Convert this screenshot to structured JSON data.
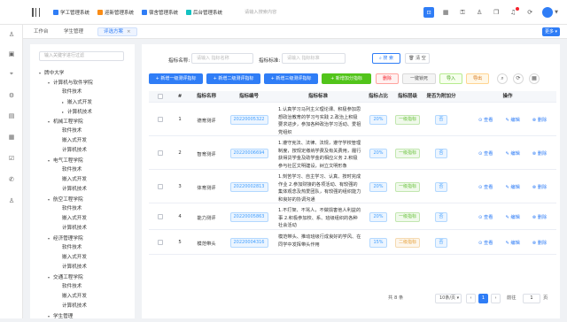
{
  "header": {
    "systems": [
      {
        "label": "学工管理系统",
        "icon": "graduation-icon",
        "color": "#2f7df6"
      },
      {
        "label": "迎新管理系统",
        "icon": "welcome-icon",
        "color": "#fa8c16"
      },
      {
        "label": "宿舍管理系统",
        "icon": "dorm-icon",
        "color": "#2f7df6"
      },
      {
        "label": "后台管理系统",
        "icon": "admin-icon",
        "color": "#13c2c2"
      }
    ],
    "search_placeholder": "请输入搜索内容",
    "icons": [
      "scan-icon",
      "calendar-icon",
      "lock-icon",
      "shirt-icon",
      "copy-icon",
      "bell-icon",
      "refresh-icon",
      "user-avatar"
    ]
  },
  "left_icons": [
    "person-icon",
    "user-card-icon",
    "pin-icon",
    "settings-icon",
    "book-icon",
    "grid-icon",
    "chart-icon",
    "phone-icon",
    "person2-icon"
  ],
  "tabs": [
    {
      "label": "工作台"
    },
    {
      "label": "学生管理"
    },
    {
      "label": "评选方案",
      "active": true
    }
  ],
  "more_label": "更多",
  "tree": {
    "search_placeholder": "输入关键字进行过滤",
    "nodes": [
      {
        "label": "牌中大学",
        "level": 0,
        "expanded": true
      },
      {
        "label": "计算机与软件学院",
        "level": 1,
        "expanded": true
      },
      {
        "label": "软件技术",
        "level": 2
      },
      {
        "label": "嵌入式开发",
        "level": 2,
        "collapsed": true
      },
      {
        "label": "计算机技术",
        "level": 2,
        "collapsed": true
      },
      {
        "label": "机械工程学院",
        "level": 1,
        "expanded": true
      },
      {
        "label": "软件技术",
        "level": 2
      },
      {
        "label": "嵌入式开发",
        "level": 2
      },
      {
        "label": "计算机技术",
        "level": 2
      },
      {
        "label": "电气工程学院",
        "level": 1,
        "expanded": true
      },
      {
        "label": "软件技术",
        "level": 2
      },
      {
        "label": "嵌入式开发",
        "level": 2
      },
      {
        "label": "计算机技术",
        "level": 2
      },
      {
        "label": "航空工程学院",
        "level": 1,
        "expanded": true
      },
      {
        "label": "软件技术",
        "level": 2
      },
      {
        "label": "嵌入式开发",
        "level": 2
      },
      {
        "label": "计算机技术",
        "level": 2
      },
      {
        "label": "经济管理学院",
        "level": 1,
        "expanded": true
      },
      {
        "label": "软件技术",
        "level": 2
      },
      {
        "label": "嵌入式开发",
        "level": 2
      },
      {
        "label": "计算机技术",
        "level": 2
      },
      {
        "label": "交通工程学院",
        "level": 1,
        "expanded": true
      },
      {
        "label": "软件技术",
        "level": 2
      },
      {
        "label": "嵌入式开发",
        "level": 2
      },
      {
        "label": "计算机技术",
        "level": 2
      },
      {
        "label": "学生管理",
        "level": 1,
        "expanded": true
      }
    ]
  },
  "filters": {
    "name_label": "指标名称:",
    "name_placeholder": "请输入 指标名称",
    "std_label": "指标标准:",
    "std_placeholder": "请输入 指标标准",
    "search_label": "搜 索",
    "clear_label": "清 空"
  },
  "toolbar": {
    "buttons": [
      {
        "label": "+ 新增一级测评指标",
        "style": "blue"
      },
      {
        "label": "+ 新增二级测评指标",
        "style": "blue"
      },
      {
        "label": "+ 新增三级测评指标",
        "style": "blue"
      },
      {
        "label": "+ 新增加分指标",
        "style": "green"
      },
      {
        "label": "删除",
        "style": "red-o"
      },
      {
        "label": "一键锁死",
        "style": "gray-o"
      },
      {
        "label": "导入",
        "style": "green-o"
      },
      {
        "label": "导出",
        "style": "orange-o"
      }
    ]
  },
  "table": {
    "columns": [
      "#",
      "指标名称",
      "指标编号",
      "指标标准",
      "指标占比",
      "指标层级",
      "是否为附加分",
      "操作"
    ],
    "rows": [
      {
        "index": "1",
        "name": "德育测评",
        "code": "20220005322",
        "standard": "1.认真学习马列主义理论课、积极参加思想政治教育的学习与实践 2.政治上积极要求进步，参加各种政治学习活动、爱祖党组织",
        "ratio": "20%",
        "level": "一级指标",
        "level_color": "green",
        "bonus": "否"
      },
      {
        "index": "2",
        "name": "智育测评",
        "code": "20220006694",
        "standard": "1.遵守宪法、法律、法规，遵守学校管理制度，按规定缴纳学费及有关费用，履行获得贷学金及助学金的相应义务 2.积极参与社区文明建设，树立文明形象",
        "ratio": "20%",
        "level": "一级指标",
        "level_color": "green",
        "bonus": "否"
      },
      {
        "index": "3",
        "name": "体育测评",
        "code": "20220002813",
        "standard": "1.刻苦学习、自主学习、认真、按时完成作业 2.参加财接的各项活动、有较强的集体观念及热爱团队，有较强的组织能力和良好的协调沟通",
        "ratio": "20%",
        "level": "一级指标",
        "level_color": "green",
        "bonus": "否"
      },
      {
        "index": "4",
        "name": "能力测评",
        "code": "20220005863",
        "standard": "1.不打架、不骂人，不做损害他人利益的事 2.积极参加校、系、班级组织的各种社会活动",
        "ratio": "20%",
        "level": "一级指标",
        "level_color": "green",
        "bonus": "否"
      },
      {
        "index": "5",
        "name": "模范带头",
        "code": "20220004316",
        "standard": "模范带头、推动班级行成良好的学风、在同学中发挥带头作用",
        "ratio": "15%",
        "level": "二级指标",
        "level_color": "orange",
        "bonus": "否"
      }
    ],
    "actions": [
      "查看",
      "编辑",
      "删除"
    ]
  },
  "pagination": {
    "total": "共 8 条",
    "page_size": "10条/页",
    "current": "1",
    "jump_label": "前往",
    "jump_value": "1",
    "page_suffix": "页"
  }
}
